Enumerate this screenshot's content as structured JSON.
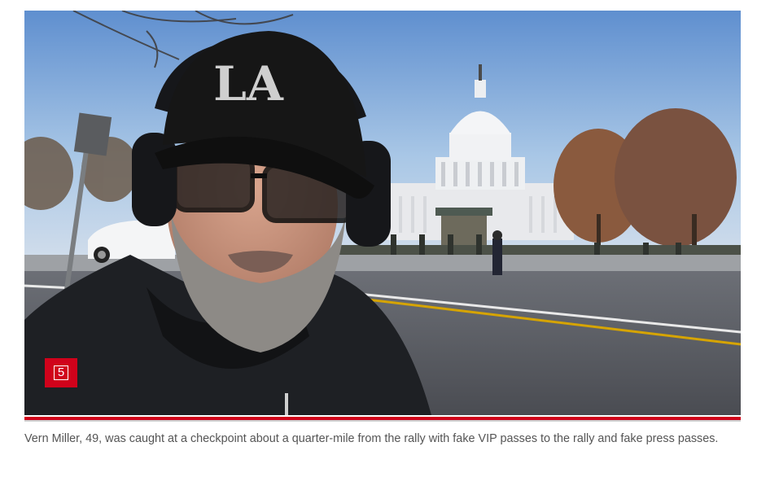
{
  "figure": {
    "gallery_count": "5",
    "caption": "Vern Miller, 49, was caught at a checkpoint about a quarter-mile from the rally with fake VIP passes to the rally and fake press passes.",
    "photo": {
      "subject": "man wearing LA cap, headphones and glasses in front of the U.S. Capitol",
      "cap_text": "LA"
    }
  },
  "colors": {
    "accent_red": "#d0021b",
    "caption_text": "#555555",
    "sky": "#8fb3d9"
  },
  "icons": {
    "gallery": "photo-count-icon"
  }
}
